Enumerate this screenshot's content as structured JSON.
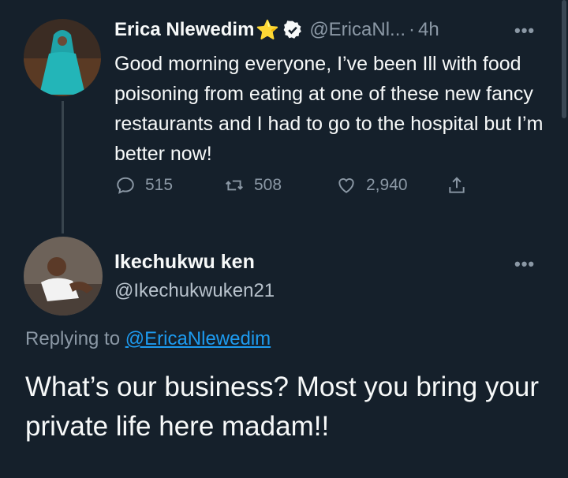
{
  "tweet": {
    "author_name": "Erica Nlewedim",
    "author_emoji": "⭐",
    "handle": "@EricaNl...",
    "separator": "·",
    "time": "4h",
    "text": "Good morning everyone, I’ve been Ill with food poisoning from eating at one of these new fancy restaurants and I had to go to the hospital but I’m better now!",
    "replies": "515",
    "retweets": "508",
    "likes": "2,940"
  },
  "reply": {
    "author_name": "Ikechukwu ken",
    "handle": "@Ikechukwuken21",
    "replying_label": "Replying to",
    "replying_to": "@EricaNlewedim",
    "text": "What’s our business? Most you bring your private life here madam!!"
  },
  "icons": {
    "verified": "verified-badge-icon",
    "more": "more-options-icon",
    "reply": "reply-icon",
    "retweet": "retweet-icon",
    "like": "like-icon",
    "share": "share-icon"
  },
  "colors": {
    "background": "#15202b",
    "text": "#f7f9f9",
    "muted": "#8b98a5",
    "link": "#1d9bf0"
  }
}
